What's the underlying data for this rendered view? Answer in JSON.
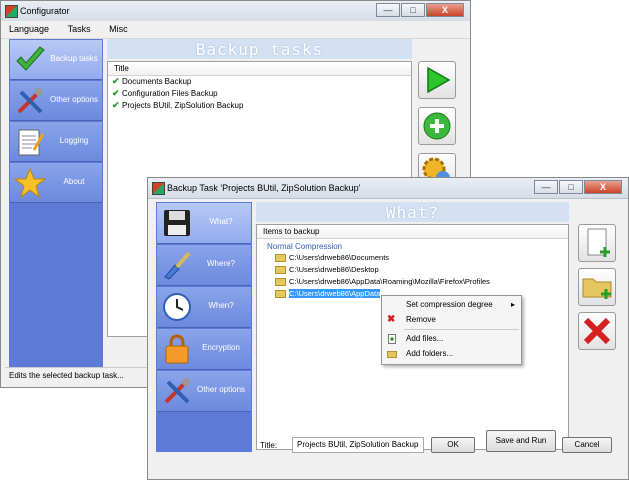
{
  "configurator": {
    "title": "Configurator",
    "window_buttons": {
      "minimize": "—",
      "maximize": "□",
      "close": "X"
    },
    "menu": [
      "Language",
      "Tasks",
      "Misc"
    ],
    "sidebar": [
      {
        "label": "Backup tasks",
        "icon": "checkmark-icon"
      },
      {
        "label": "Other options",
        "icon": "tools-icon"
      },
      {
        "label": "Logging",
        "icon": "notepad-icon"
      },
      {
        "label": "About",
        "icon": "star-icon"
      }
    ],
    "panel_title": "Backup tasks",
    "column_header": "Title",
    "tasks": [
      "Documents Backup",
      "Configuration Files Backup",
      "Projects BUtil, ZipSolution Backup"
    ],
    "status": "Edits the selected backup task..."
  },
  "dialog": {
    "title": "Backup Task 'Projects BUtil, ZipSolution Backup'",
    "window_buttons": {
      "minimize": "—",
      "maximize": "□",
      "close": "X"
    },
    "sidebar": [
      {
        "label": "What?",
        "icon": "floppy-disk-icon"
      },
      {
        "label": "Where?",
        "icon": "brush-icon"
      },
      {
        "label": "When?",
        "icon": "clock-icon"
      },
      {
        "label": "Encryption",
        "icon": "lock-icon"
      },
      {
        "label": "Other options",
        "icon": "tools-icon"
      }
    ],
    "panel_title": "What?",
    "column_header": "Items to backup",
    "group": "Normal Compression",
    "paths": [
      "C:\\Users\\drweb86\\Documents",
      "C:\\Users\\drweb86\\Desktop",
      "C:\\Users\\drweb86\\AppData\\Roaming\\Mozilla\\Firefox\\Profiles",
      "C:\\Users\\drweb86\\AppData"
    ],
    "context_menu": {
      "set_compression": "Set compression degree",
      "remove": "Remove",
      "add_files": "Add files...",
      "add_folders": "Add folders...",
      "submenu_arrow": "▸"
    },
    "title_label": "Title:",
    "title_value": "Projects BUtil, ZipSolution Backup",
    "ok": "OK",
    "save_run": "Save and Run",
    "cancel": "Cancel"
  }
}
